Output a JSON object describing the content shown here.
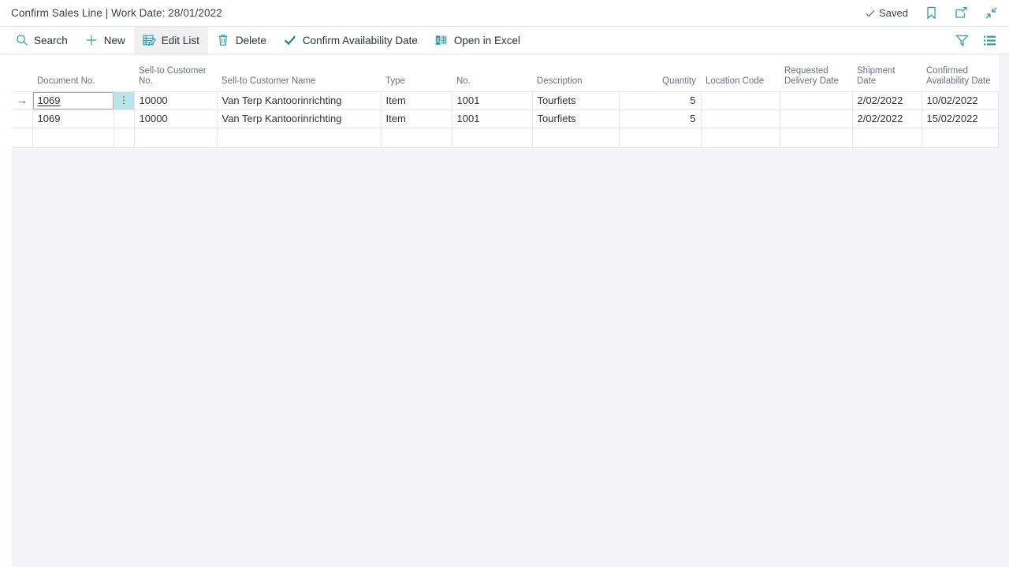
{
  "titlebar": {
    "title": "Confirm Sales Line | Work Date: 28/01/2022",
    "saved_label": "Saved",
    "icons": {
      "bookmark": "bookmark-icon",
      "open_new_window": "open-in-new-window-icon",
      "collapse": "collapse-icon"
    }
  },
  "commandbar": {
    "items": [
      {
        "label": "Search",
        "icon": "search-icon",
        "active": false
      },
      {
        "label": "New",
        "icon": "plus-icon",
        "active": false
      },
      {
        "label": "Edit List",
        "icon": "edit-list-icon",
        "active": true
      },
      {
        "label": "Delete",
        "icon": "trash-icon",
        "active": false
      },
      {
        "label": "Confirm Availability Date",
        "icon": "checkmark-icon",
        "active": false
      },
      {
        "label": "Open in Excel",
        "icon": "excel-icon",
        "active": false
      }
    ],
    "right_icons": [
      {
        "name": "filter-icon"
      },
      {
        "name": "list-view-icon"
      }
    ]
  },
  "grid": {
    "columns": [
      {
        "key": "document_no",
        "label": "Document No.",
        "align": "left"
      },
      {
        "key": "sell_to_customer_no",
        "label": "Sell-to Customer No.",
        "align": "left"
      },
      {
        "key": "sell_to_customer_name",
        "label": "Sell-to Customer Name",
        "align": "left"
      },
      {
        "key": "type",
        "label": "Type",
        "align": "left"
      },
      {
        "key": "no",
        "label": "No.",
        "align": "left"
      },
      {
        "key": "description",
        "label": "Description",
        "align": "left"
      },
      {
        "key": "quantity",
        "label": "Quantity",
        "align": "right"
      },
      {
        "key": "location_code",
        "label": "Location Code",
        "align": "left"
      },
      {
        "key": "requested_delivery_date",
        "label": "Requested Delivery Date",
        "align": "left"
      },
      {
        "key": "shipment_date",
        "label": "Shipment Date",
        "align": "left"
      },
      {
        "key": "confirmed_availability_date",
        "label": "Confirmed Availability Date",
        "align": "left"
      }
    ],
    "rows": [
      {
        "document_no": "1069",
        "sell_to_customer_no": "10000",
        "sell_to_customer_name": "Van Terp Kantoorinrichting",
        "type": "Item",
        "no": "1001",
        "description": "Tourfiets",
        "quantity": "5",
        "location_code": "",
        "requested_delivery_date": "",
        "shipment_date": "2/02/2022",
        "confirmed_availability_date": "10/02/2022"
      },
      {
        "document_no": "1069",
        "sell_to_customer_no": "10000",
        "sell_to_customer_name": "Van Terp Kantoorinrichting",
        "type": "Item",
        "no": "1001",
        "description": "Tourfiets",
        "quantity": "5",
        "location_code": "",
        "requested_delivery_date": "",
        "shipment_date": "2/02/2022",
        "confirmed_availability_date": "15/02/2022"
      }
    ],
    "selected_row_index": 0,
    "selected_column_key": "document_no",
    "row_indicator_glyph": "→",
    "row_menu_glyph": "⋮"
  },
  "colors": {
    "accent_teal": "#2e9aa4",
    "selection_cyan": "#b9e4e8",
    "text_primary": "#2f3238",
    "text_muted": "#6d7179",
    "pane_background": "#f4f4f6"
  }
}
